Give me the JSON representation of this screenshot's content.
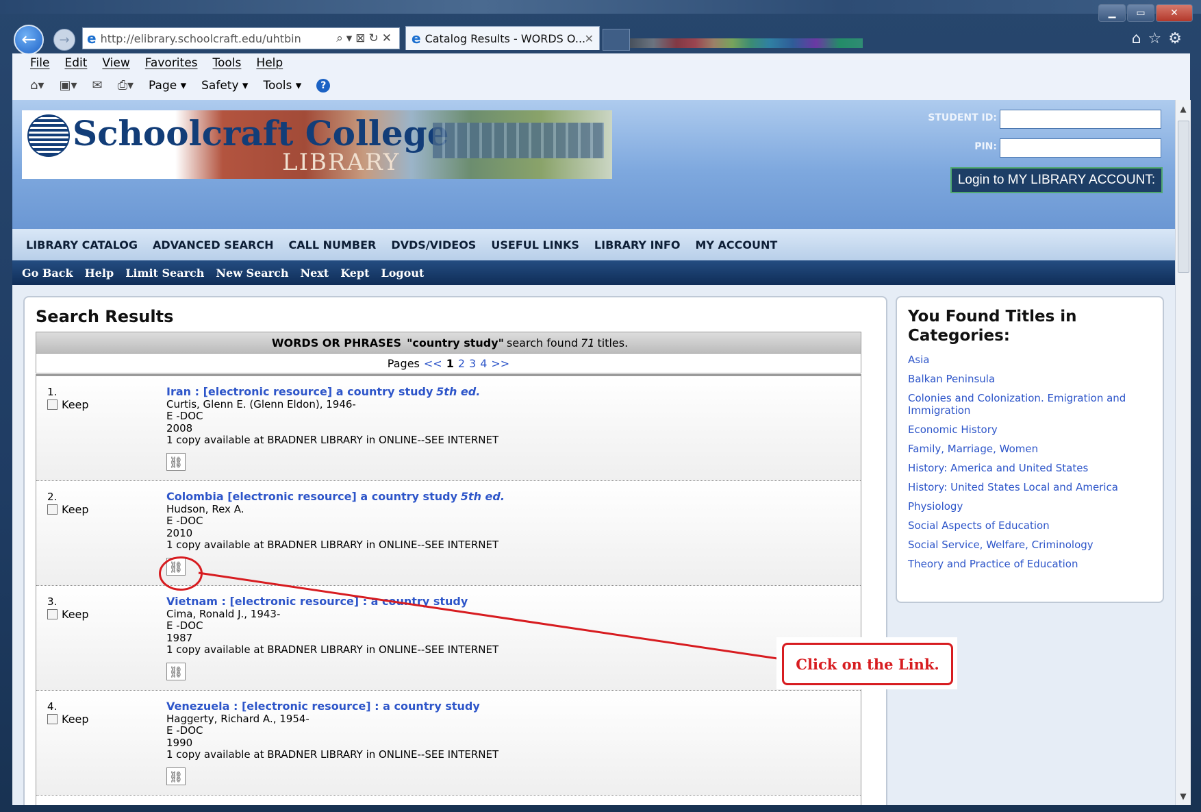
{
  "browser": {
    "url": "http://elibrary.schoolcraft.edu/uhtbin",
    "tab_title": "Catalog Results - WORDS O...",
    "menu": [
      "File",
      "Edit",
      "View",
      "Favorites",
      "Tools",
      "Help"
    ],
    "commands": [
      "Page",
      "Safety",
      "Tools"
    ]
  },
  "site": {
    "logo_text": "Schoolcraft College",
    "logo_sub": "LIBRARY",
    "student_id_label": "STUDENT ID:",
    "pin_label": "PIN:",
    "login_button": "Login to MY LIBRARY ACCOUNT:",
    "top_nav": [
      "LIBRARY CATALOG",
      "ADVANCED SEARCH",
      "CALL NUMBER",
      "DVDS/VIDEOS",
      "USEFUL LINKS",
      "LIBRARY INFO",
      "MY ACCOUNT"
    ],
    "sub_nav": [
      "Go Back",
      "Help",
      "Limit Search",
      "New Search",
      "Next",
      "Kept",
      "Logout"
    ]
  },
  "results": {
    "heading": "Search Results",
    "summary_prefix": "WORDS OR PHRASES",
    "summary_query": "\"country study\"",
    "summary_mid": "search found",
    "summary_count": "71",
    "summary_suffix": "titles.",
    "pages_label": "Pages",
    "pages_prev": "<<",
    "pages_current": "1",
    "pages_other": [
      "2",
      "3",
      "4"
    ],
    "pages_next": ">>",
    "keep_label": "Keep",
    "items": [
      {
        "num": "1.",
        "title": "Iran : [electronic resource] a country study",
        "edition": "5th ed.",
        "author": "Curtis, Glenn E. (Glenn Eldon), 1946-",
        "type": "E -DOC",
        "year": "2008",
        "availability": "1 copy available at BRADNER LIBRARY in ONLINE--SEE INTERNET"
      },
      {
        "num": "2.",
        "title": "Colombia [electronic resource] a country study",
        "edition": "5th ed.",
        "author": "Hudson, Rex A.",
        "type": "E -DOC",
        "year": "2010",
        "availability": "1 copy available at BRADNER LIBRARY in ONLINE--SEE INTERNET"
      },
      {
        "num": "3.",
        "title": "Vietnam : [electronic resource] : a country study",
        "edition": "",
        "author": "Cima, Ronald J., 1943-",
        "type": "E -DOC",
        "year": "1987",
        "availability": "1 copy available at BRADNER LIBRARY in ONLINE--SEE INTERNET"
      },
      {
        "num": "4.",
        "title": "Venezuela : [electronic resource] : a country study",
        "edition": "",
        "author": "Haggerty, Richard A., 1954-",
        "type": "E -DOC",
        "year": "1990",
        "availability": "1 copy available at BRADNER LIBRARY in ONLINE--SEE INTERNET"
      }
    ]
  },
  "categories": {
    "heading": "You Found Titles in Categories:",
    "items": [
      "Asia",
      "Balkan Peninsula",
      "Colonies and Colonization. Emigration and Immigration",
      "Economic History",
      "Family, Marriage, Women",
      "History: America and United States",
      "History: United States Local and America",
      "Physiology",
      "Social Aspects of Education",
      "Social Service, Welfare, Criminology",
      "Theory and Practice of Education"
    ]
  },
  "annotation": {
    "text": "Click on the Link."
  },
  "colors": {
    "link": "#2d55c9",
    "annotation": "#d71c20",
    "subnav_bg": "#0f2d57"
  }
}
